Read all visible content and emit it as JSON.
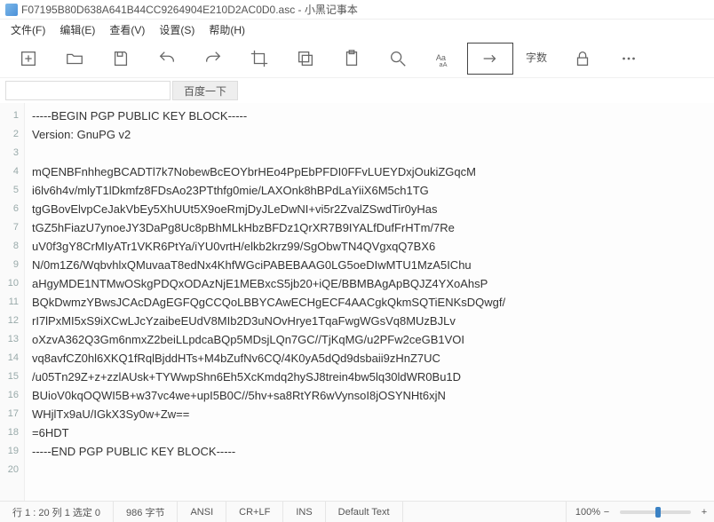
{
  "title": "F07195B80D638A641B44CC9264904E210D2AC0D0.asc - 小黑记事本",
  "menu": {
    "file": "文件(F)",
    "edit": "编辑(E)",
    "view": "查看(V)",
    "settings": "设置(S)",
    "help": "帮助(H)"
  },
  "toolbar": {
    "zishu_label": "字数"
  },
  "search": {
    "placeholder": "",
    "button_label": "百度一下"
  },
  "lines": [
    "-----BEGIN PGP PUBLIC KEY BLOCK-----",
    "Version: GnuPG v2",
    "",
    "mQENBFnhhegBCADTl7k7NobewBcEOYbrHEo4PpEbPFDI0FFvLUEYDxjOukiZGqcM",
    "i6lv6h4v/mlyT1lDkmfz8FDsAo23PTthfg0mie/LAXOnk8hBPdLaYiiX6M5ch1TG",
    "tgGBovElvpCeJakVbEy5XhUUt5X9oeRmjDyJLeDwNI+vi5r2ZvalZSwdTir0yHas",
    "tGZ5hFiazU7ynoeJY3DaPg8Uc8pBhMLkHbzBFDz1QrXR7B9IYALfDufFrHTm/7Re",
    "uV0f3gY8CrMIyATr1VKR6PtYa/iYU0vrtH/elkb2krz99/SgObwTN4QVgxqQ7BX6",
    "N/0m1Z6/WqbvhlxQMuvaaT8edNx4KhfWGciPABEBAAG0LG5oeDIwMTU1MzA5IChu",
    "aHgyMDE1NTMwOSkgPDQxODAzNjE1MEBxcS5jb20+iQE/BBMBAgApBQJZ4YXoAhsP",
    "BQkDwmzYBwsJCAcDAgEGFQgCCQoLBBYCAwECHgECF4AACgkQkmSQTiENKsDQwgf/",
    "rI7lPxMI5xS9iXCwLJcYzaibeEUdV8MIb2D3uNOvHrye1TqaFwgWGsVq8MUzBJLv",
    "oXzvA362Q3Gm6nmxZ2beiLLpdcaBQp5MDsjLQn7GC//TjKqMG/u2PFw2ceGB1VOI",
    "vq8avfCZ0hl6XKQ1fRqlBjddHTs+M4bZufNv6CQ/4K0yA5dQd9dsbaii9zHnZ7UC",
    "/u05Tn29Z+z+zzlAUsk+TYWwpShn6Eh5XcKmdq2hySJ8trein4bw5lq30ldWR0Bu1D",
    "BUioV0kqOQWI5B+w37vc4we+upI5B0C//5hv+sa8RtYR6wVynsoI8jOSYNHt6xjN",
    "WHjlTx9aU/IGkX3Sy0w+Zw==",
    "=6HDT",
    "-----END PGP PUBLIC KEY BLOCK-----",
    ""
  ],
  "status": {
    "pos": "行 1 : 20  列 1  选定 0",
    "bytes": "986 字节",
    "encoding": "ANSI",
    "eol": "CR+LF",
    "mode": "INS",
    "lang": "Default Text",
    "zoom": "100%"
  }
}
